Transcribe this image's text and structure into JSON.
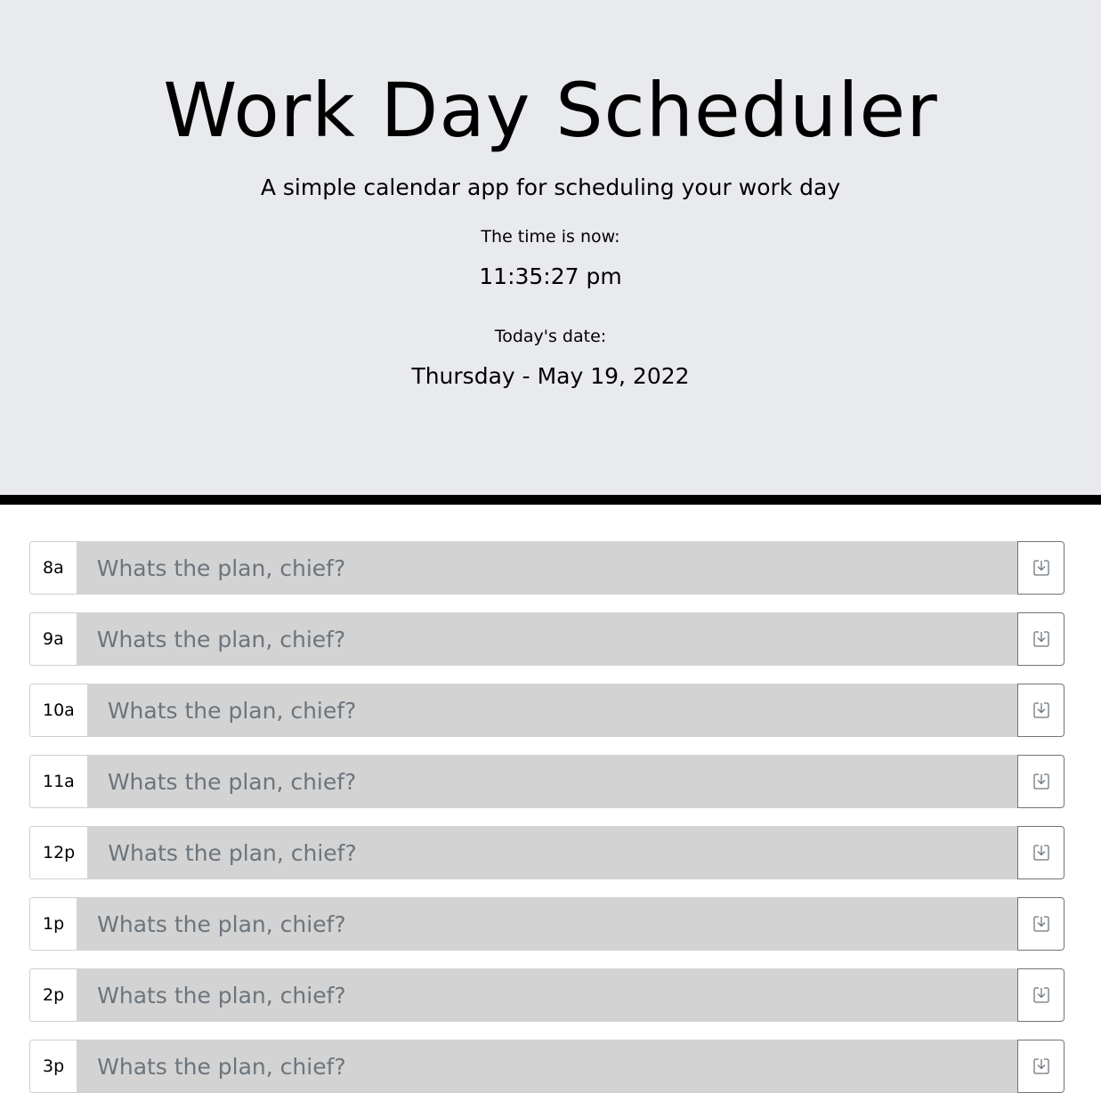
{
  "header": {
    "title": "Work Day Scheduler",
    "subtitle": "A simple calendar app for scheduling your work day",
    "time_label": "The time is now:",
    "time_value": "11:35:27 pm",
    "date_label": "Today's date:",
    "date_value": "Thursday - May 19, 2022"
  },
  "colors": {
    "header_bg": "#e9eaee",
    "divider": "#000000",
    "plan_bg": "#d3d3d3",
    "placeholder": "#6c757d"
  },
  "schedule": {
    "placeholder": "Whats the plan, chief?",
    "save_icon": "save-icon",
    "rows": [
      {
        "hour": "8a",
        "value": ""
      },
      {
        "hour": "9a",
        "value": ""
      },
      {
        "hour": "10a",
        "value": ""
      },
      {
        "hour": "11a",
        "value": ""
      },
      {
        "hour": "12p",
        "value": ""
      },
      {
        "hour": "1p",
        "value": ""
      },
      {
        "hour": "2p",
        "value": ""
      },
      {
        "hour": "3p",
        "value": ""
      }
    ]
  }
}
